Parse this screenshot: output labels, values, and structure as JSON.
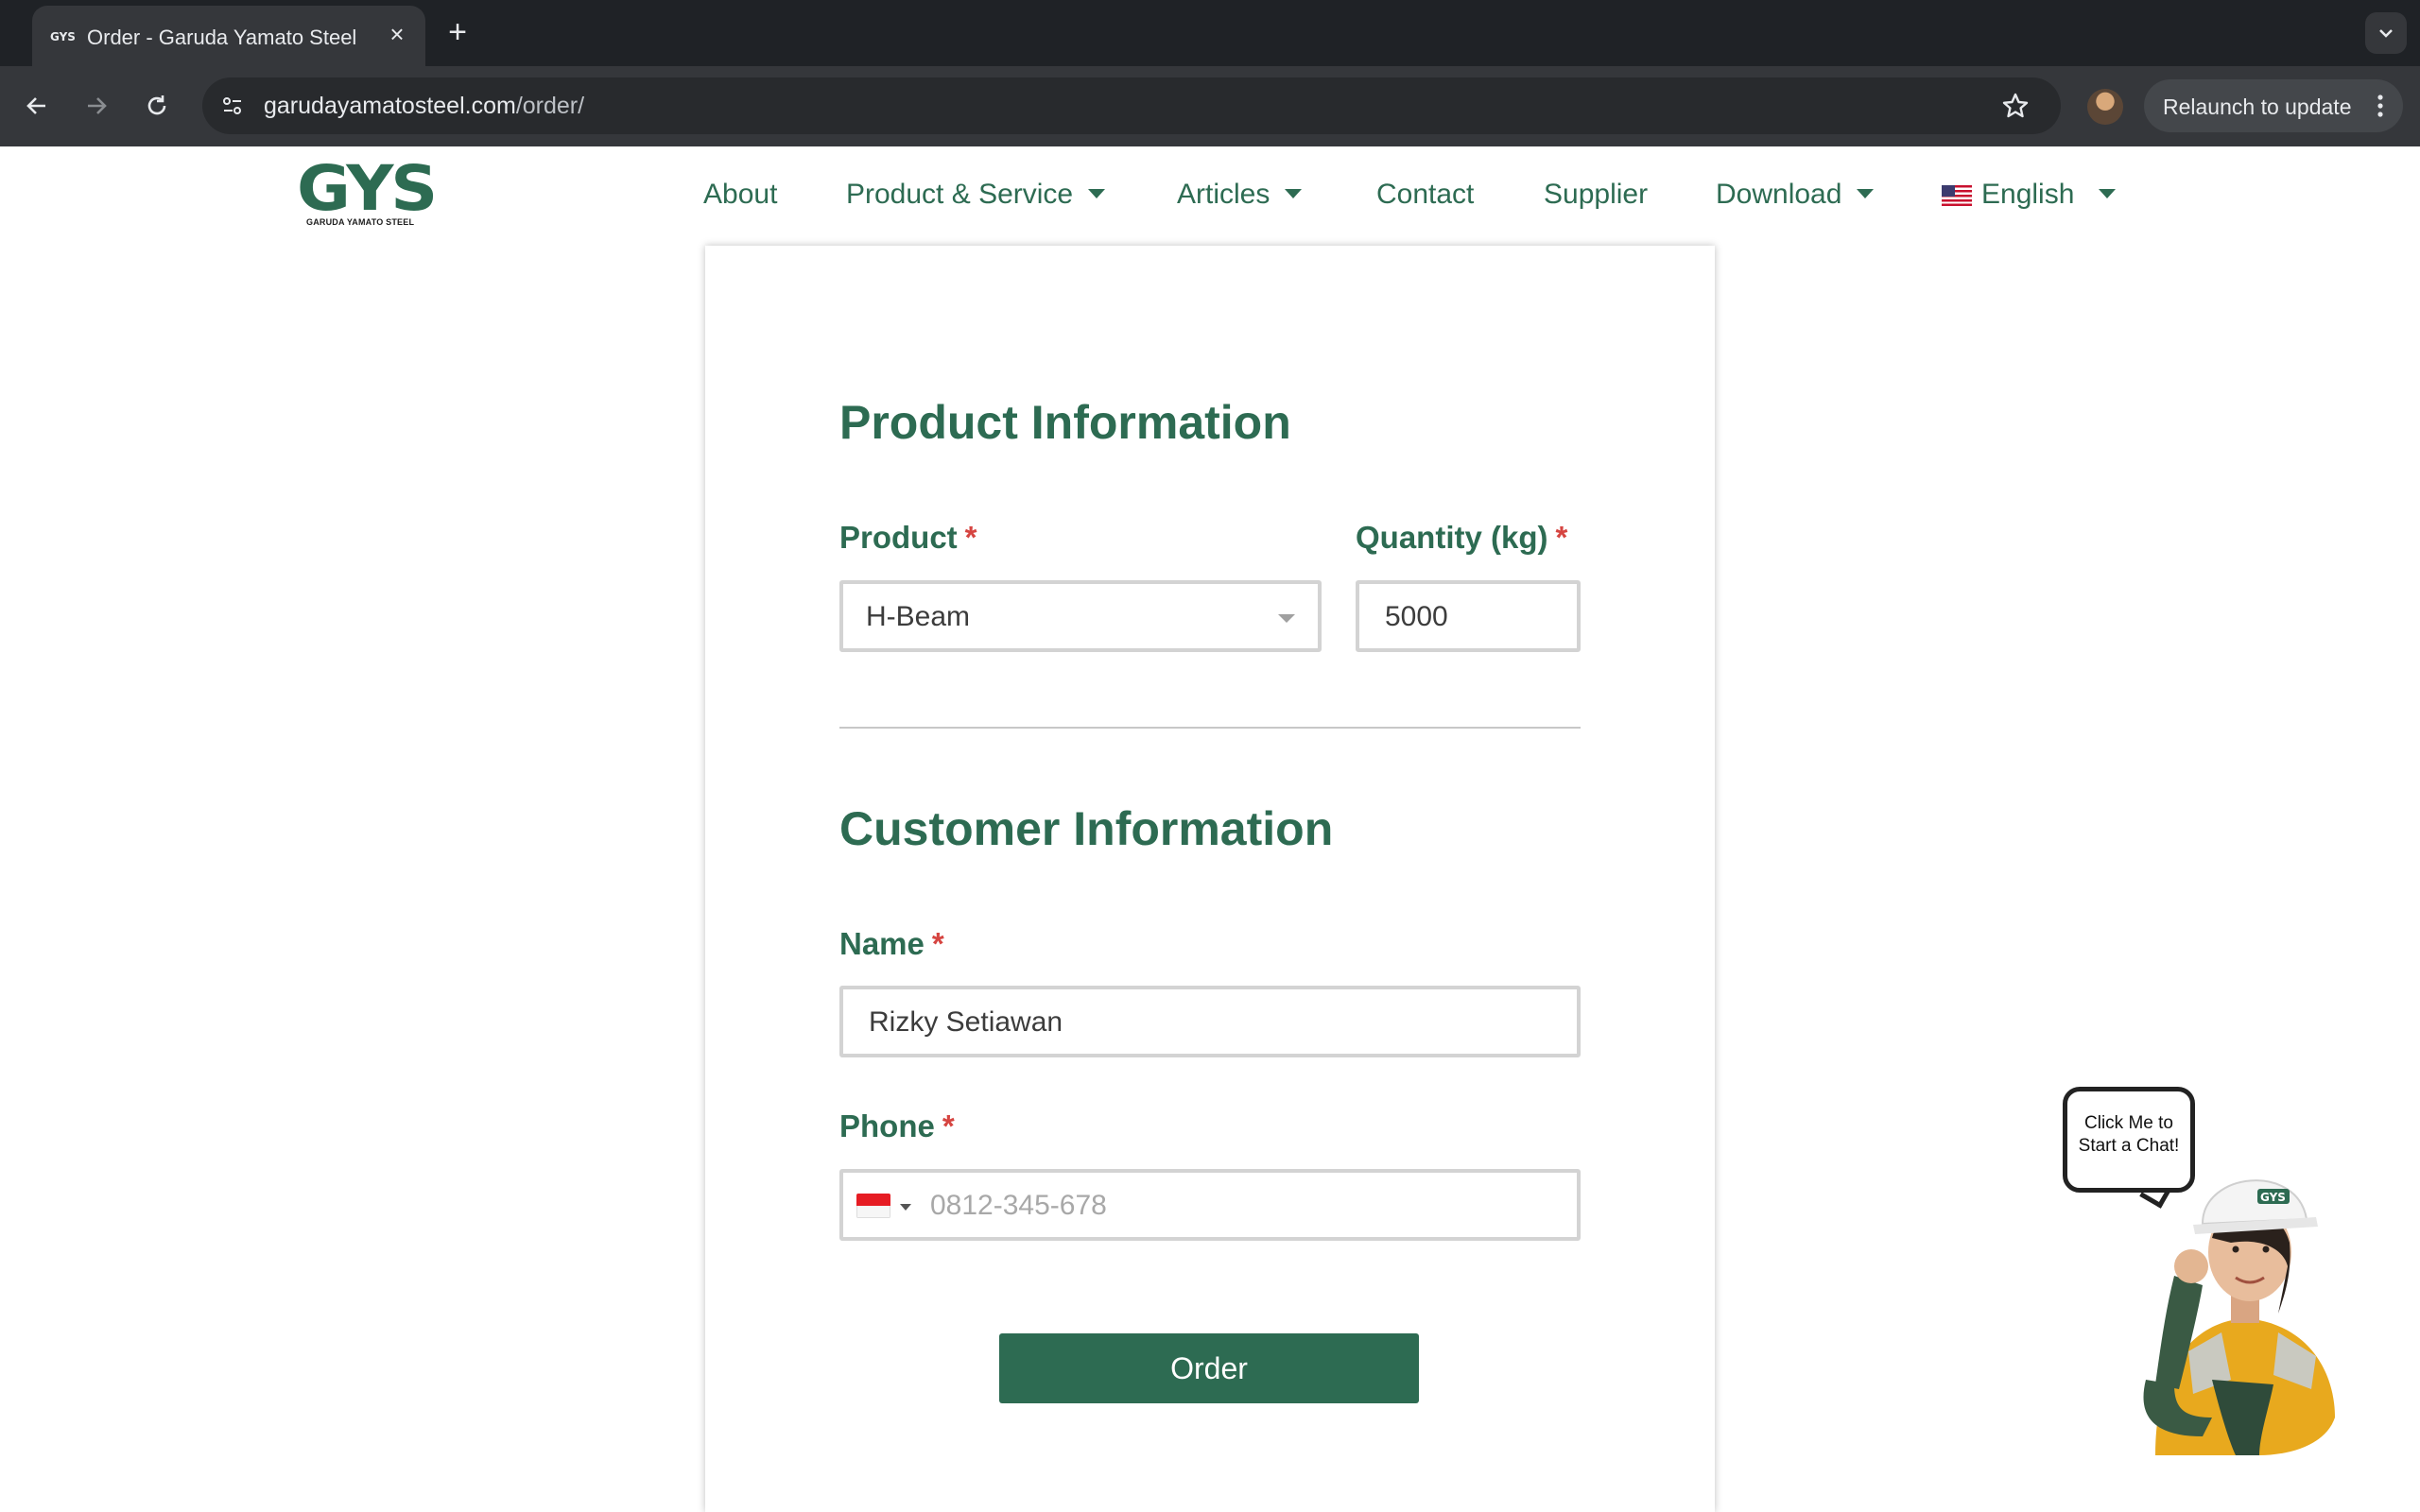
{
  "browser": {
    "tab_title": "Order - Garuda Yamato Steel",
    "url_domain": "garudayamatosteel.com",
    "url_path": "/order/",
    "relaunch_label": "Relaunch to update"
  },
  "site": {
    "logo_text": "GYS",
    "logo_subtext": "GARUDA YAMATO STEEL",
    "nav": {
      "about": "About",
      "product_service": "Product & Service",
      "articles": "Articles",
      "contact": "Contact",
      "supplier": "Supplier",
      "download": "Download",
      "language": "English"
    },
    "brand_color": "#2d6b52"
  },
  "form": {
    "product_section_title": "Product Information",
    "product_label": "Product",
    "product_value": "H-Beam",
    "quantity_label": "Quantity (kg)",
    "quantity_value": "5000",
    "customer_section_title": "Customer Information",
    "name_label": "Name",
    "name_value": "Rizky Setiawan",
    "phone_label": "Phone",
    "phone_placeholder": "0812-345-678",
    "required_marker": "*",
    "order_button": "Order"
  },
  "chat": {
    "bubble_line1": "Click Me to",
    "bubble_line2": "Start a Chat!",
    "helmet_text": "GYS"
  }
}
